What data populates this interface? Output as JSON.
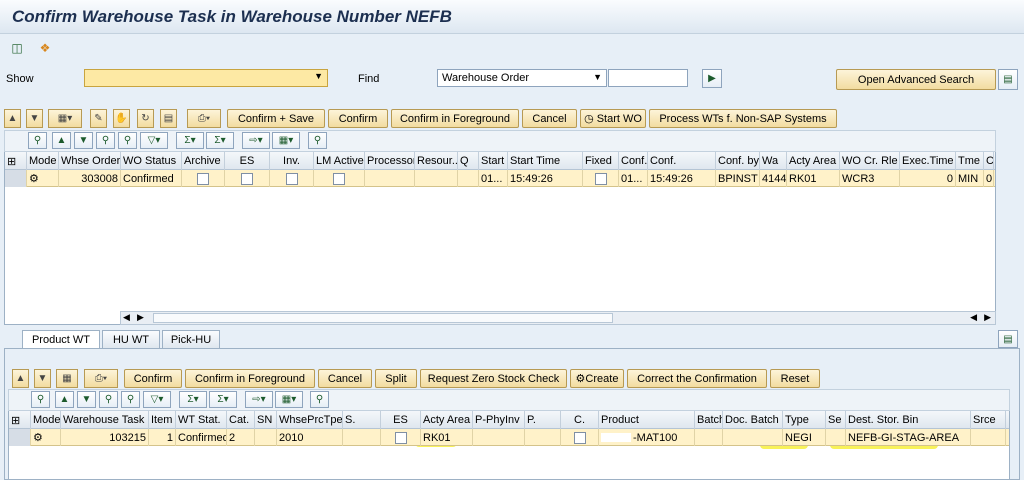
{
  "title": "Confirm Warehouse Task in Warehouse Number NEFB",
  "toolbar": {
    "icon1": "tree-icon",
    "icon2": "transaction-icon"
  },
  "selection": {
    "show_label": "Show",
    "show_value": "",
    "find_label": "Find",
    "find_value": "Warehouse Order",
    "find_input": "",
    "open_adv": "Open Advanced Search"
  },
  "top_buttons": {
    "confirm_save": "Confirm + Save",
    "confirm": "Confirm",
    "confirm_fg": "Confirm in Foreground",
    "cancel": "Cancel",
    "start_wo": "Start WO",
    "process": "Process WTs f. Non-SAP Systems"
  },
  "wo_table": {
    "headers": [
      "",
      "Mode",
      "Whse Order",
      "WO Status",
      "Archive",
      "ES",
      "Inv.",
      "LM Active",
      "Processor",
      "Resour...",
      "Q",
      "Start",
      "Start Time",
      "Fixed",
      "Conf.",
      "Conf.",
      "Conf. by",
      "Wa",
      "Acty Area",
      "WO Cr. Rle",
      "Exec.Time",
      "Tme",
      "C"
    ],
    "row": {
      "mode": "",
      "whse_order": "303008",
      "status": "Confirmed",
      "start": "01...",
      "start_time": "15:49:26",
      "conf": "01...",
      "conf_time": "15:49:26",
      "conf_by": "BPINST",
      "wa": "4144",
      "acty_area": "RK01",
      "wo_rule": "WCR3",
      "exec_time": "0",
      "tme": "MIN",
      "c": "0"
    }
  },
  "tabs": [
    "Product WT",
    "HU WT",
    "Pick-HU"
  ],
  "bottom_buttons": {
    "confirm": "Confirm",
    "confirm_fg": "Confirm in Foreground",
    "cancel": "Cancel",
    "split": "Split",
    "request_zero": "Request Zero Stock Check",
    "create": "Create",
    "correct": "Correct the Confirmation",
    "reset": "Reset"
  },
  "wt_table": {
    "headers": [
      "",
      "Mode",
      "Warehouse Task",
      "Item",
      "WT Stat.",
      "Cat.",
      "SN",
      "WhsePrcTpe",
      "S.",
      "ES",
      "Acty Area",
      "P-PhyInv",
      "P.",
      "C.",
      "Product",
      "Batch",
      "Doc. Batch",
      "Type",
      "Se",
      "Dest. Stor. Bin",
      "Srce"
    ],
    "row": {
      "task": "103215",
      "item": "1",
      "status": "Confirmed",
      "cat": "2",
      "prc": "2010",
      "acty": "RK01",
      "product": "-MAT100",
      "type": "NEGI",
      "dest": "NEFB-GI-STAG-AREA"
    }
  }
}
